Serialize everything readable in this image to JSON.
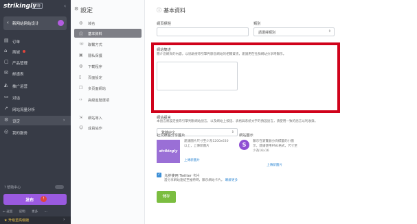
{
  "app": {
    "logo": "strikingly",
    "logo_badge": "天鹿",
    "collapse_icon": "chevron-left-icon"
  },
  "site": {
    "name": "新网站网站设计"
  },
  "sidebar": {
    "items": [
      {
        "icon": "clipboard-icon",
        "label": "订单"
      },
      {
        "icon": "store-icon",
        "label": "商城"
      },
      {
        "icon": "box-icon",
        "label": "产品管理"
      },
      {
        "icon": "mail-icon",
        "label": "邮递表"
      },
      {
        "icon": "megaphone-icon",
        "label": "推广运营"
      },
      {
        "icon": "chat-icon",
        "label": "对话"
      },
      {
        "icon": "chart-icon",
        "label": "网站流量分析"
      },
      {
        "icon": "gear-icon",
        "label": "设定"
      },
      {
        "icon": "compass-icon",
        "label": "我的服务"
      }
    ],
    "help_label": "? 帮助中心",
    "publish_label": "发布",
    "publish_badge": "!",
    "bottom_links": [
      "← 返回",
      "说明",
      "更多",
      "···"
    ],
    "upgrade_label": "★ 升级至高级版"
  },
  "settings": {
    "title": "設定",
    "items": [
      {
        "icon": "globe-icon",
        "label": "域名"
      },
      {
        "icon": "info-icon",
        "label": "基本資料"
      },
      {
        "icon": "phone-icon",
        "label": "聯繫方式"
      },
      {
        "icon": "lock-icon",
        "label": "隱私保護"
      },
      {
        "icon": "globe-icon",
        "label": "下載程序"
      },
      {
        "icon": "page-icon",
        "label": "頁面設定"
      },
      {
        "icon": "layers-icon",
        "label": "多頁面網站"
      },
      {
        "icon": "code-icon",
        "label": "高級進階選項"
      },
      {
        "icon": "import-icon",
        "label": "網站導入"
      },
      {
        "icon": "users-icon",
        "label": "成員協作"
      }
    ]
  },
  "form": {
    "title": "基本資料",
    "site_title_label": "網頁標題",
    "category_label": "類別",
    "category_value": "請選擇類別",
    "desc_label": "網站簡述",
    "desc_help": "簡介您網頁的內容，以協助搜尋引擎判斷您網站的相關資訊，建議用在社群網站分享時顯示。",
    "lang_label": "網站語言",
    "lang_help": "本語言將設定搜尋引擎判斷網站語言，以及網站上按鈕、表格與系統文字的預設語言，請使用一致的語言以利收錄。",
    "lang_value": "繁體中文",
    "share_label": "社交媒體分享圖片",
    "share_thumb": "strikingly",
    "share_help": "建議圖片尺寸至少為1200x630以上，上傳新圖片",
    "share_link": "上傳新圖片",
    "favicon_label": "網站圖示",
    "favicon_letter": "S",
    "favicon_help": "顯示在瀏覽器分頁標籤的小圖示，建議使用PNG格式，尺寸至少為16x16",
    "favicon_link": "上傳新圖片",
    "twitter_label": "允許使用 Twitter 卡片",
    "twitter_help": "當分享網站連結至推特時，顯示網站卡片。",
    "twitter_link": "瞭解更多",
    "save_label": "儲存"
  }
}
